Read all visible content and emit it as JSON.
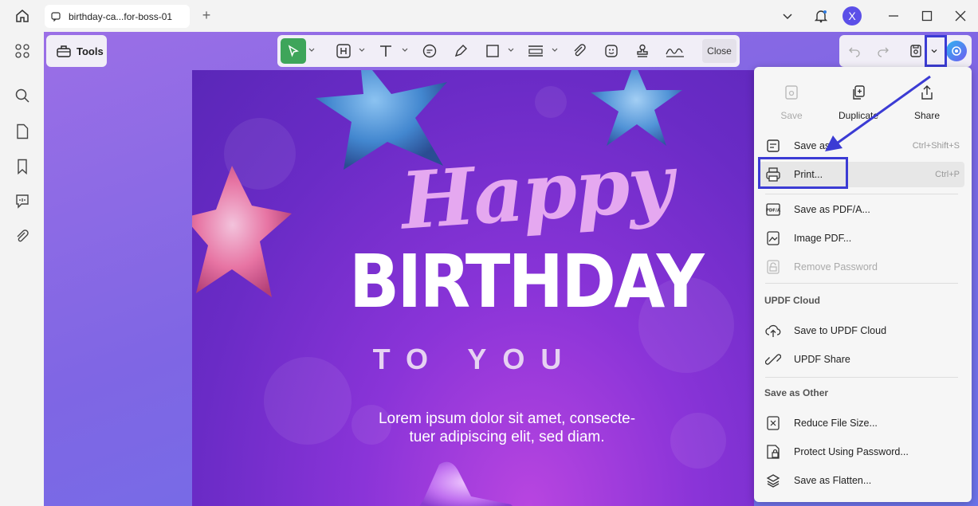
{
  "titlebar": {
    "tab_title": "birthday-ca...for-boss-01",
    "new_tab": "+",
    "avatar_letter": "X"
  },
  "toolbar": {
    "tools_label": "Tools",
    "close_label": "Close"
  },
  "document": {
    "happy": "Happy",
    "birthday": "BIRTHDAY",
    "to_you": "TO YOU",
    "lorem_line1": "Lorem ipsum dolor sit amet, consecte-",
    "lorem_line2": "tuer adipiscing elit, sed diam."
  },
  "menu": {
    "top_buttons": [
      {
        "label": "Save",
        "icon": "save-icon",
        "disabled": true
      },
      {
        "label": "Duplicate",
        "icon": "duplicate-icon",
        "disabled": false
      },
      {
        "label": "Share",
        "icon": "share-icon",
        "disabled": false
      }
    ],
    "items": [
      {
        "label": "Save as",
        "shortcut": "Ctrl+Shift+S",
        "icon": "save-as-icon"
      },
      {
        "label": "Print...",
        "shortcut": "Ctrl+P",
        "icon": "printer-icon"
      },
      {
        "label": "Save as PDF/A...",
        "icon": "pdfa-icon"
      },
      {
        "label": "Image PDF...",
        "icon": "image-pdf-icon"
      },
      {
        "label": "Remove Password",
        "icon": "unlock-icon",
        "disabled": true
      }
    ],
    "cloud_header": "UPDF Cloud",
    "cloud_items": [
      {
        "label": "Save to UPDF Cloud",
        "icon": "cloud-upload-icon"
      },
      {
        "label": "UPDF Share",
        "icon": "link-icon"
      }
    ],
    "other_header": "Save as Other",
    "other_items": [
      {
        "label": "Reduce File Size...",
        "icon": "reduce-size-icon"
      },
      {
        "label": "Protect Using Password...",
        "icon": "shield-lock-icon"
      },
      {
        "label": "Save as Flatten...",
        "icon": "flatten-icon"
      }
    ]
  },
  "colors": {
    "accent_green": "#3ea55a",
    "highlight_blue": "#3b3bd4",
    "avatar_bg": "#5b4fe8"
  }
}
